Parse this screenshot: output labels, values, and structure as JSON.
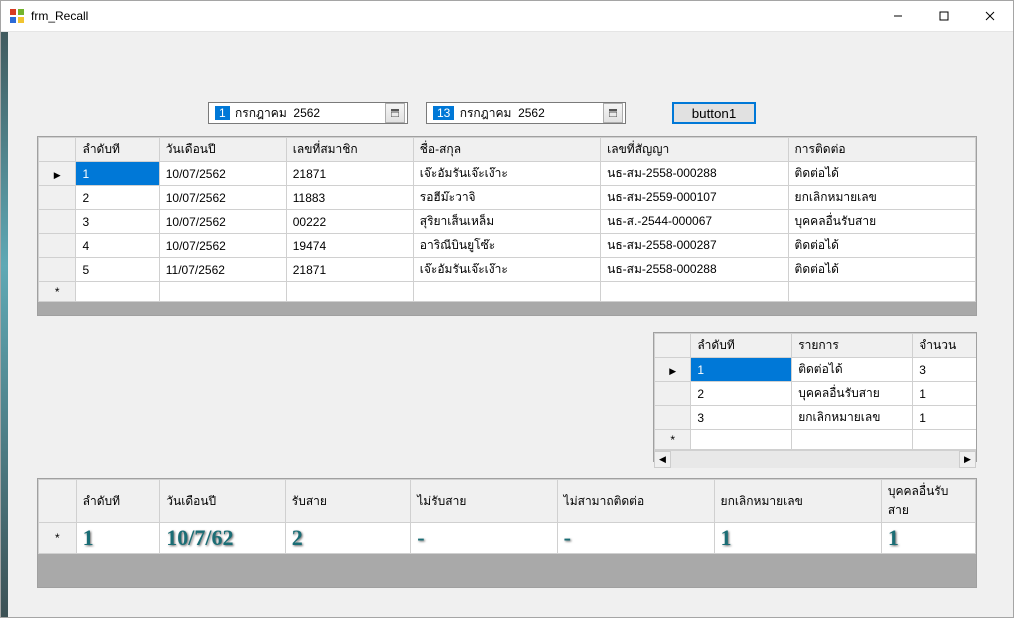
{
  "window": {
    "title": "frm_Recall"
  },
  "datepickers": {
    "from_day": "1",
    "from_rest": " กรกฎาคม  2562",
    "to_day": "13",
    "to_rest": " กรกฎาคม  2562"
  },
  "button1_label": "button1",
  "grid1": {
    "headers": [
      "ลำดับที",
      "วันเดือนปี",
      "เลขที่สมาชิก",
      "ชื่อ-สกุล",
      "เลขที่สัญญา",
      "การติดต่อ"
    ],
    "rows": [
      [
        "1",
        "10/07/2562",
        "21871",
        "เจ๊ะอัมรันเจ๊ะเง๊าะ",
        "นธ-สม-2558-000288",
        "ติดต่อได้"
      ],
      [
        "2",
        "10/07/2562",
        "11883",
        "รอฮีม๊ะวาจิ",
        "นธ-สม-2559-000107",
        "ยกเลิกหมายเลข"
      ],
      [
        "3",
        "10/07/2562",
        "00222",
        "สุริยาเส็นเหล็ม",
        "นธ-ส.-2544-000067",
        "บุคคลอื่นรับสาย"
      ],
      [
        "4",
        "10/07/2562",
        "19474",
        "อาริณีบินยูโซ๊ะ",
        "นธ-สม-2558-000287",
        "ติดต่อได้"
      ],
      [
        "5",
        "11/07/2562",
        "21871",
        "เจ๊ะอัมรันเจ๊ะเง๊าะ",
        "นธ-สม-2558-000288",
        "ติดต่อได้"
      ]
    ]
  },
  "grid2": {
    "headers": [
      "ลำดับที",
      "รายการ",
      "จำนวน"
    ],
    "rows": [
      [
        "1",
        "ติดต่อได้",
        "3"
      ],
      [
        "2",
        "บุคคลอื่นรับสาย",
        "1"
      ],
      [
        "3",
        "ยกเลิกหมายเลข",
        "1"
      ]
    ]
  },
  "grid3": {
    "headers": [
      "ลำดับที",
      "วันเดือนปี",
      "รับสาย",
      "ไม่รับสาย",
      "ไม่สามาถติดต่อ",
      "ยกเลิกหมายเลข",
      "บุคคลอื่นรับสาย"
    ],
    "hand_row": [
      "1",
      "10/7/62",
      "2",
      "-",
      "-",
      "1",
      "1"
    ]
  }
}
